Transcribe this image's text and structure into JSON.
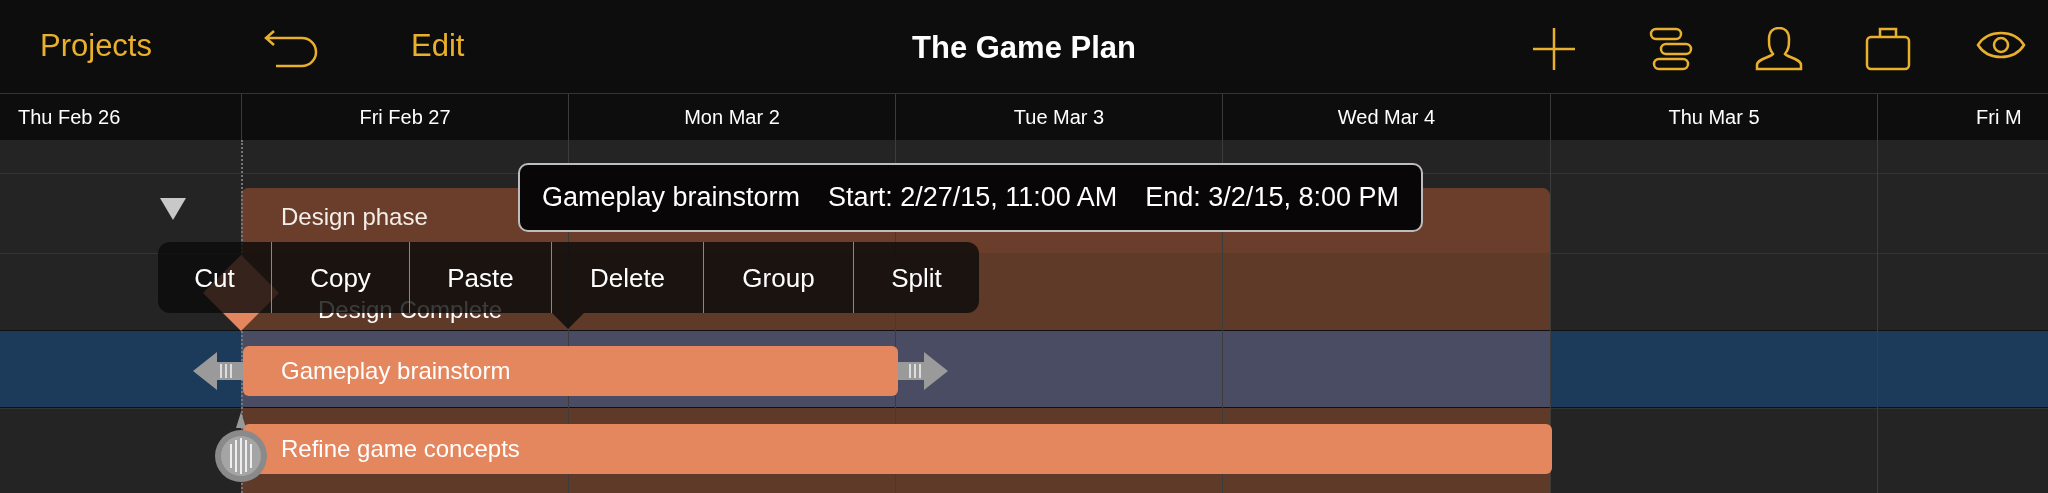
{
  "toolbar": {
    "left_buttons": [
      "Projects",
      "Edit"
    ],
    "title": "The Game Plan"
  },
  "timeline": {
    "dates": [
      "Thu Feb 26",
      "Fri Feb 27",
      "Mon Mar 2",
      "Tue Mar 3",
      "Wed Mar 4",
      "Thu Mar 5",
      "Fri M"
    ]
  },
  "tasks": [
    {
      "kind": "group",
      "name": "Design phase",
      "expanded": true
    },
    {
      "kind": "milestone",
      "name": "Design Complete"
    },
    {
      "kind": "task",
      "name": "Gameplay brainstorm",
      "selected": true
    },
    {
      "kind": "task",
      "name": "Refine game concepts",
      "selected": false
    }
  ],
  "tooltip": {
    "title": "Gameplay brainstorm",
    "start": "Start: 2/27/15, 11:00 AM",
    "end": "End: 3/2/15, 8:00 PM"
  },
  "context_menu": {
    "items": [
      "Cut",
      "Copy",
      "Paste",
      "Delete",
      "Group",
      "Split"
    ]
  }
}
